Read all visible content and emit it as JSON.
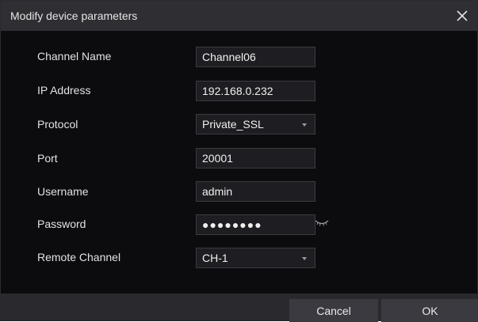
{
  "dialog": {
    "title": "Modify device parameters",
    "close_icon": "close-icon"
  },
  "fields": {
    "channel_name": {
      "label": "Channel Name",
      "value": "Channel06"
    },
    "ip_address": {
      "label": "IP Address",
      "value": "192.168.0.232"
    },
    "protocol": {
      "label": "Protocol",
      "value": "Private_SSL"
    },
    "port": {
      "label": "Port",
      "value": "20001"
    },
    "username": {
      "label": "Username",
      "value": "admin"
    },
    "password": {
      "label": "Password",
      "masked_value": "●●●●●●●●",
      "toggle_icon": "eye-closed-icon"
    },
    "remote_channel": {
      "label": "Remote Channel",
      "value": "CH-1"
    }
  },
  "footer": {
    "cancel_label": "Cancel",
    "ok_label": "OK"
  },
  "colors": {
    "background": "#0c0c0f",
    "titlebar": "#2e2e33",
    "field_bg": "#1e1e22",
    "button_bg": "#3a3a40"
  }
}
